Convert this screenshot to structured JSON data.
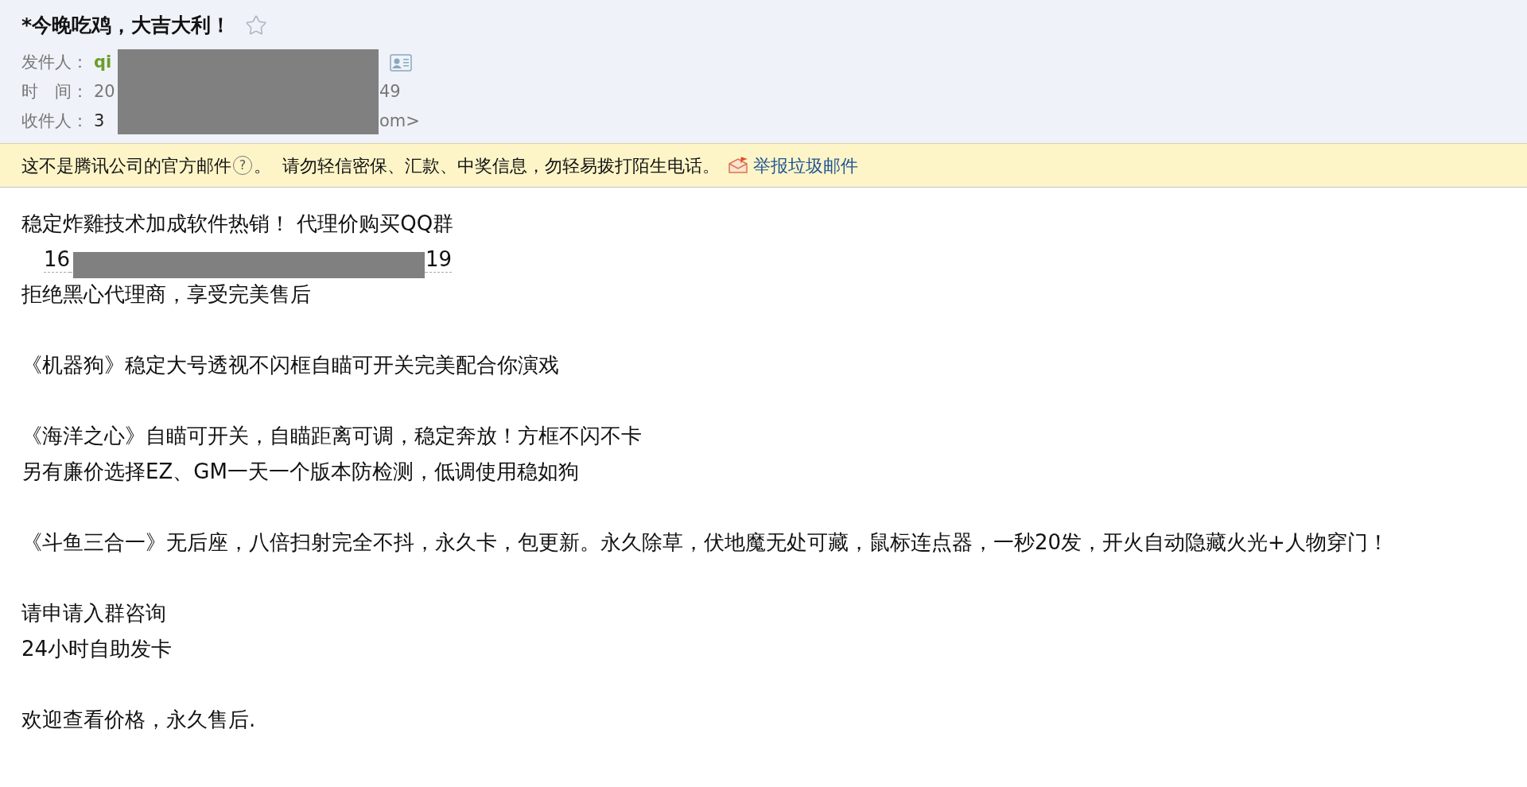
{
  "email": {
    "subject": "*今晚吃鸡，大吉大利！",
    "header_rows": [
      {
        "kind": "sender",
        "label": "发件人：",
        "prefix": "qi"
      },
      {
        "kind": "time",
        "label": "时　间：",
        "prefix": "20",
        "suffix": "49"
      },
      {
        "kind": "recipient",
        "label": "收件人：",
        "prefix": "3",
        "suffix": "om>"
      }
    ]
  },
  "notice": {
    "text_before": "这不是腾讯公司的官方邮件",
    "help": "?",
    "text_after": "。  请勿轻信密保、汇款、中奖信息，勿轻易拨打陌生电话。",
    "report_link": "举报垃圾邮件"
  },
  "body": {
    "paragraphs": [
      [
        {
          "kind": "text",
          "text": "稳定炸雞技术加成软件热销！  代理价购买QQ群"
        },
        {
          "kind": "qq",
          "prefix": "16",
          "suffix": "19"
        },
        {
          "kind": "text",
          "text": "拒绝黑心代理商，享受完美售后"
        }
      ],
      [
        {
          "kind": "text",
          "text": "《机器狗》稳定大号透视不闪框自瞄可开关完美配合你演戏"
        }
      ],
      [
        {
          "kind": "text",
          "text": "《海洋之心》自瞄可开关，自瞄距离可调，稳定奔放！方框不闪不卡"
        },
        {
          "kind": "text",
          "text": "另有廉价选择EZ、GM一天一个版本防检测，低调使用稳如狗"
        }
      ],
      [
        {
          "kind": "text",
          "text": "《斗鱼三合一》无后座，八倍扫射完全不抖，永久卡，包更新。永久除草，伏地魔无处可藏，鼠标连点器，一秒20发，开火自动隐藏火光+人物穿门！"
        }
      ],
      [
        {
          "kind": "text",
          "text": "请申请入群咨询"
        },
        {
          "kind": "text",
          "text": "24小时自助发卡"
        }
      ],
      [
        {
          "kind": "text",
          "text": "欢迎查看价格，永久售后."
        }
      ]
    ]
  }
}
